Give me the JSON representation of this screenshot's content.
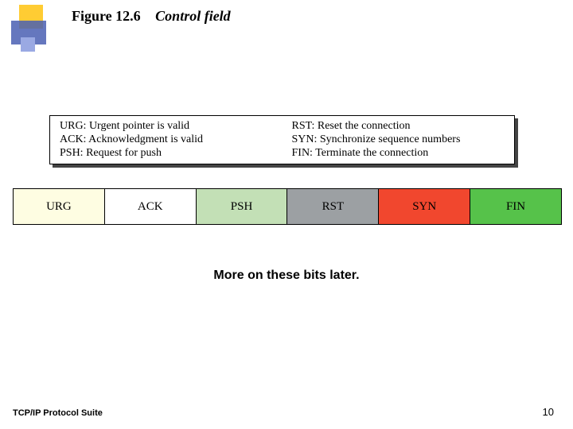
{
  "title": {
    "figure_label": "Figure 12.6",
    "subtitle": "Control field"
  },
  "definitions": {
    "left": [
      "URG: Urgent pointer is valid",
      "ACK: Acknowledgment is valid",
      "PSH: Request for push"
    ],
    "right": [
      "RST: Reset the connection",
      "SYN: Synchronize sequence numbers",
      "FIN: Terminate the connection"
    ]
  },
  "bits": [
    {
      "label": "URG",
      "color": "#fefde2"
    },
    {
      "label": "ACK",
      "color": "#ffffff"
    },
    {
      "label": "PSH",
      "color": "#c3e0b6"
    },
    {
      "label": "RST",
      "color": "#9ca0a3"
    },
    {
      "label": "SYN",
      "color": "#f1472e"
    },
    {
      "label": "FIN",
      "color": "#56c24a"
    }
  ],
  "caption": "More on these bits later.",
  "footer": {
    "left": "TCP/IP Protocol Suite",
    "page": "10"
  }
}
